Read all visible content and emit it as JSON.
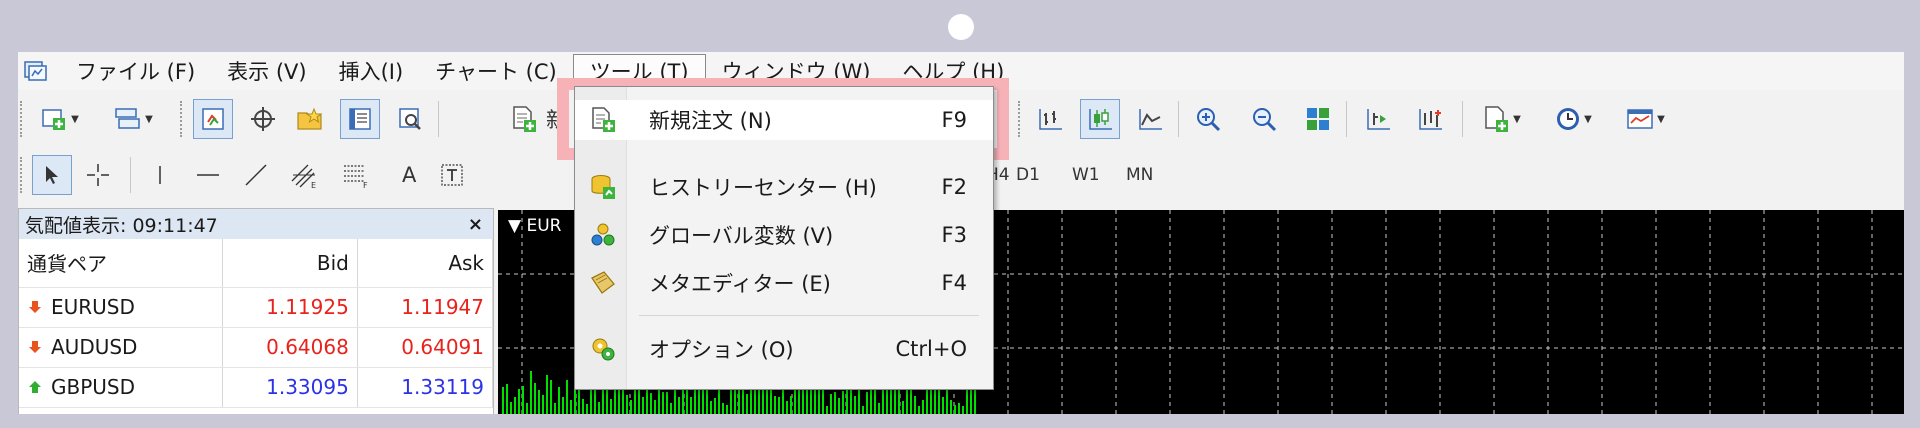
{
  "menubar": {
    "items": [
      {
        "label": "ファイル (F)"
      },
      {
        "label": "表示 (V)"
      },
      {
        "label": "挿入(I)"
      },
      {
        "label": "チャート (C)"
      },
      {
        "label": "ツール (T)"
      },
      {
        "label": "ウィンドウ (W)"
      },
      {
        "label": "ヘルプ (H)"
      }
    ]
  },
  "toolbar": {
    "new_order_partial": "新",
    "timeframes": [
      "H4",
      "D1",
      "W1",
      "MN"
    ],
    "text_tool": "A"
  },
  "tools_menu": {
    "items": [
      {
        "label": "新規注文 (N)",
        "shortcut": "F9",
        "icon": "new-order-icon"
      },
      {
        "label": "ヒストリーセンター (H)",
        "shortcut": "F2",
        "icon": "history-center-icon"
      },
      {
        "label": "グローバル変数 (V)",
        "shortcut": "F3",
        "icon": "global-variables-icon"
      },
      {
        "label": "メタエディター (E)",
        "shortcut": "F4",
        "icon": "meta-editor-icon"
      },
      {
        "label": "オプション (O)",
        "shortcut": "Ctrl+O",
        "icon": "options-icon"
      }
    ]
  },
  "market_watch": {
    "title": "気配値表示: 09:11:47",
    "close": "×",
    "headers": {
      "symbol": "通貨ペア",
      "bid": "Bid",
      "ask": "Ask"
    },
    "rows": [
      {
        "symbol": "EURUSD",
        "bid": "1.11925",
        "ask": "1.11947",
        "direction": "down"
      },
      {
        "symbol": "AUDUSD",
        "bid": "0.64068",
        "ask": "0.64091",
        "direction": "down"
      },
      {
        "symbol": "GBPUSD",
        "bid": "1.33095",
        "ask": "1.33119",
        "direction": "up"
      }
    ]
  },
  "chart": {
    "label": "EUR",
    "colors": {
      "background": "#000000",
      "grid": "#c8c8c8",
      "bars": "#00e000"
    }
  },
  "colors": {
    "highlight": "#f7b2b8",
    "down": "#e8221c",
    "up": "#2b32e8"
  }
}
